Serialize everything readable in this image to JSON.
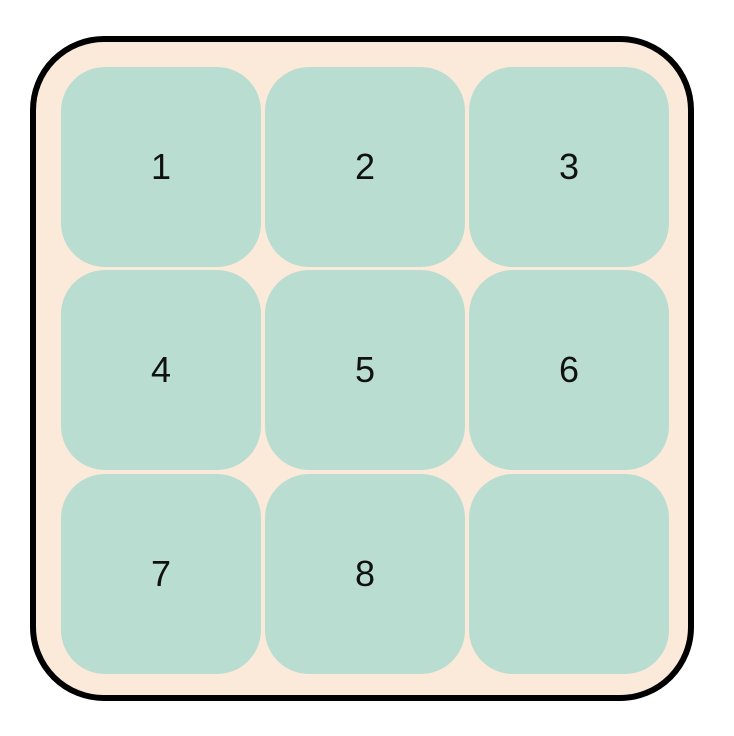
{
  "puzzle": {
    "tiles": [
      "1",
      "2",
      "3",
      "4",
      "5",
      "6",
      "7",
      "8",
      ""
    ],
    "colors": {
      "board_background": "#fbe9d9",
      "board_border": "#000000",
      "tile_background": "#b9ded1",
      "tile_text": "#111111"
    }
  }
}
